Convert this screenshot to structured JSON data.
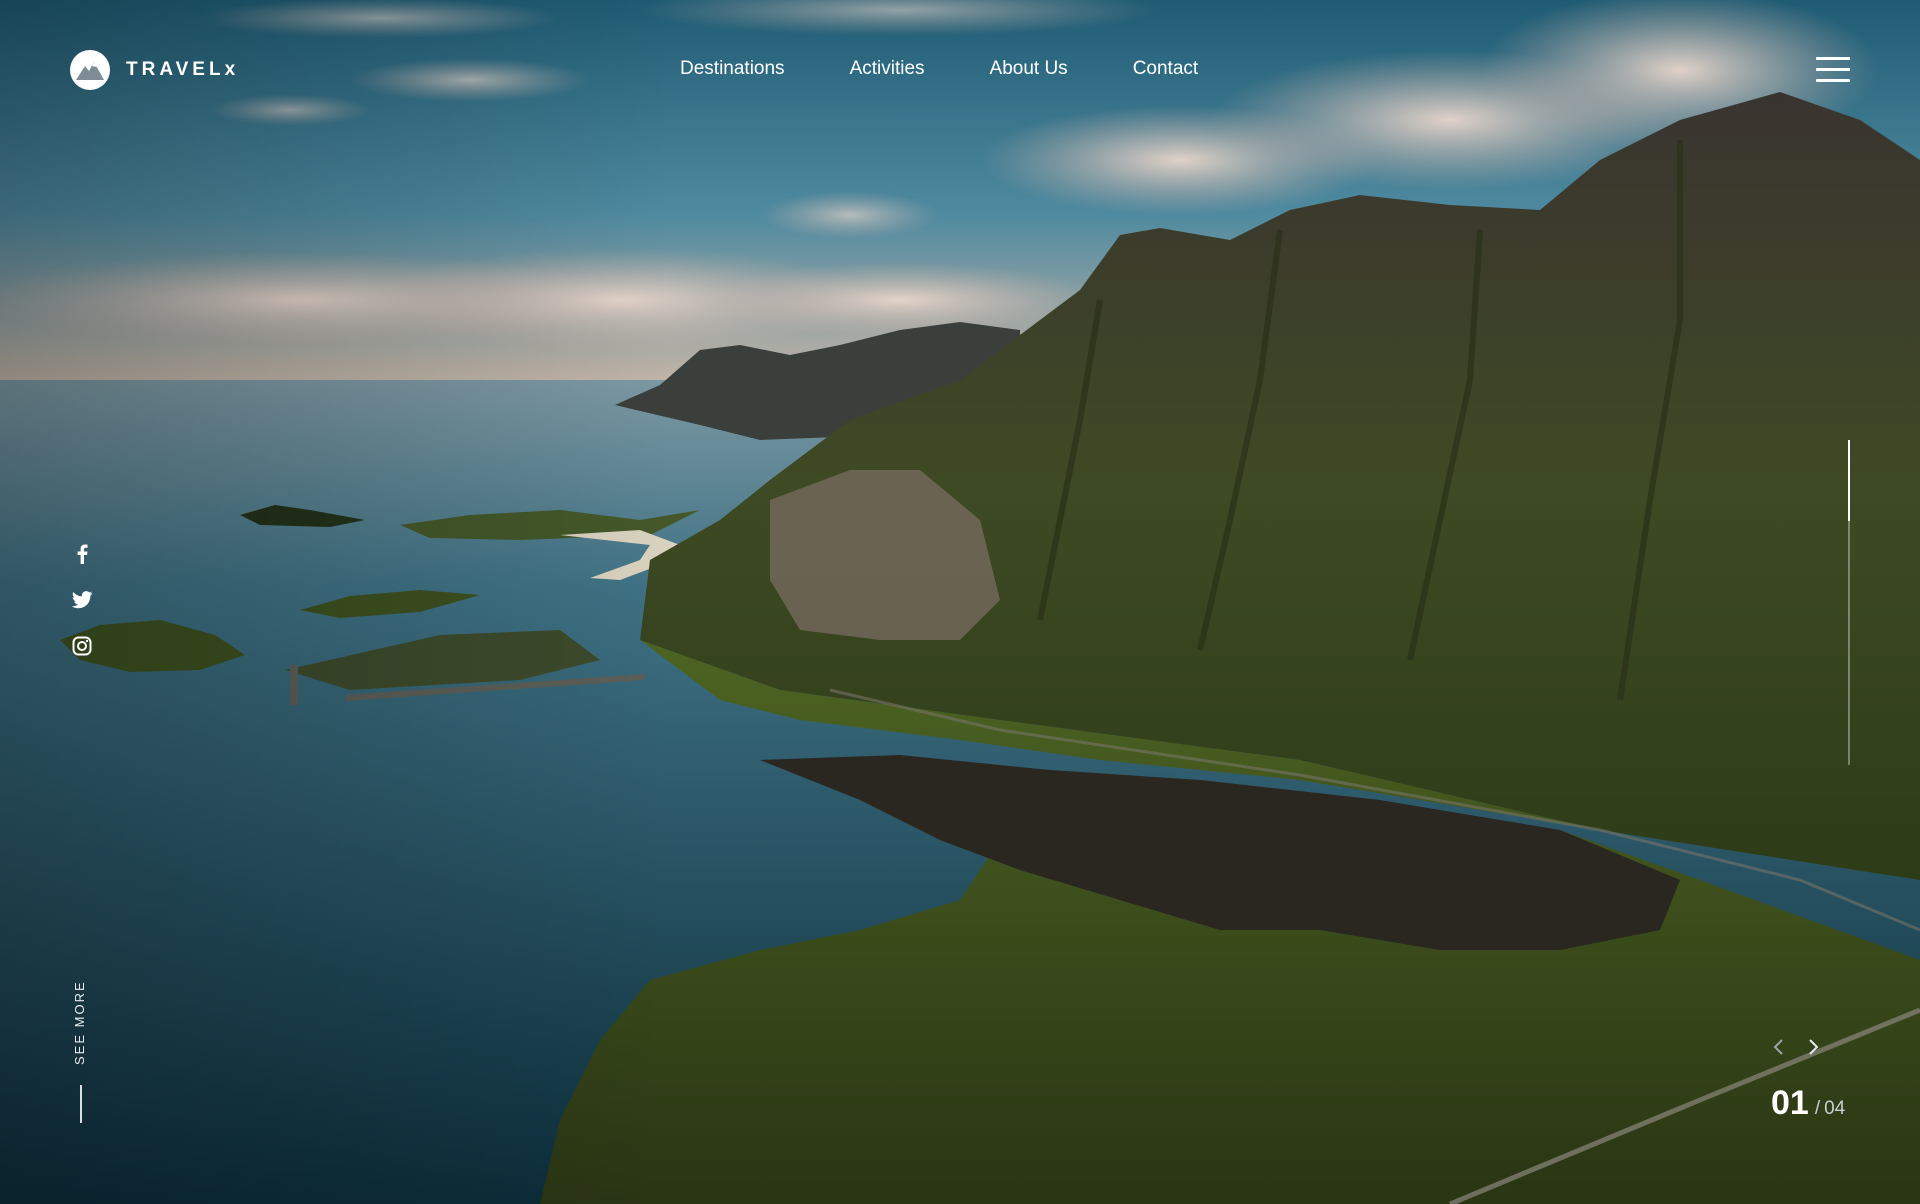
{
  "brand": {
    "name": "TRAVELx",
    "logo_icon": "mountain-icon"
  },
  "nav": {
    "links": [
      {
        "label": "Destinations"
      },
      {
        "label": "Activities"
      },
      {
        "label": "About Us"
      },
      {
        "label": "Contact"
      }
    ],
    "menu_icon": "hamburger-menu-icon"
  },
  "social": {
    "icons": [
      "facebook-icon",
      "twitter-icon",
      "instagram-icon"
    ]
  },
  "see_more": {
    "label": "SEE MORE"
  },
  "slider": {
    "current": "01",
    "separator": "/",
    "total": "04",
    "progress": 0.25,
    "prev_icon": "chevron-left-icon",
    "next_icon": "chevron-right-icon"
  },
  "colors": {
    "text": "#ffffff",
    "muted": "#c7d0d4",
    "sky": "#2f6f87",
    "sea": "#1e5668",
    "grass": "#4d6422"
  }
}
